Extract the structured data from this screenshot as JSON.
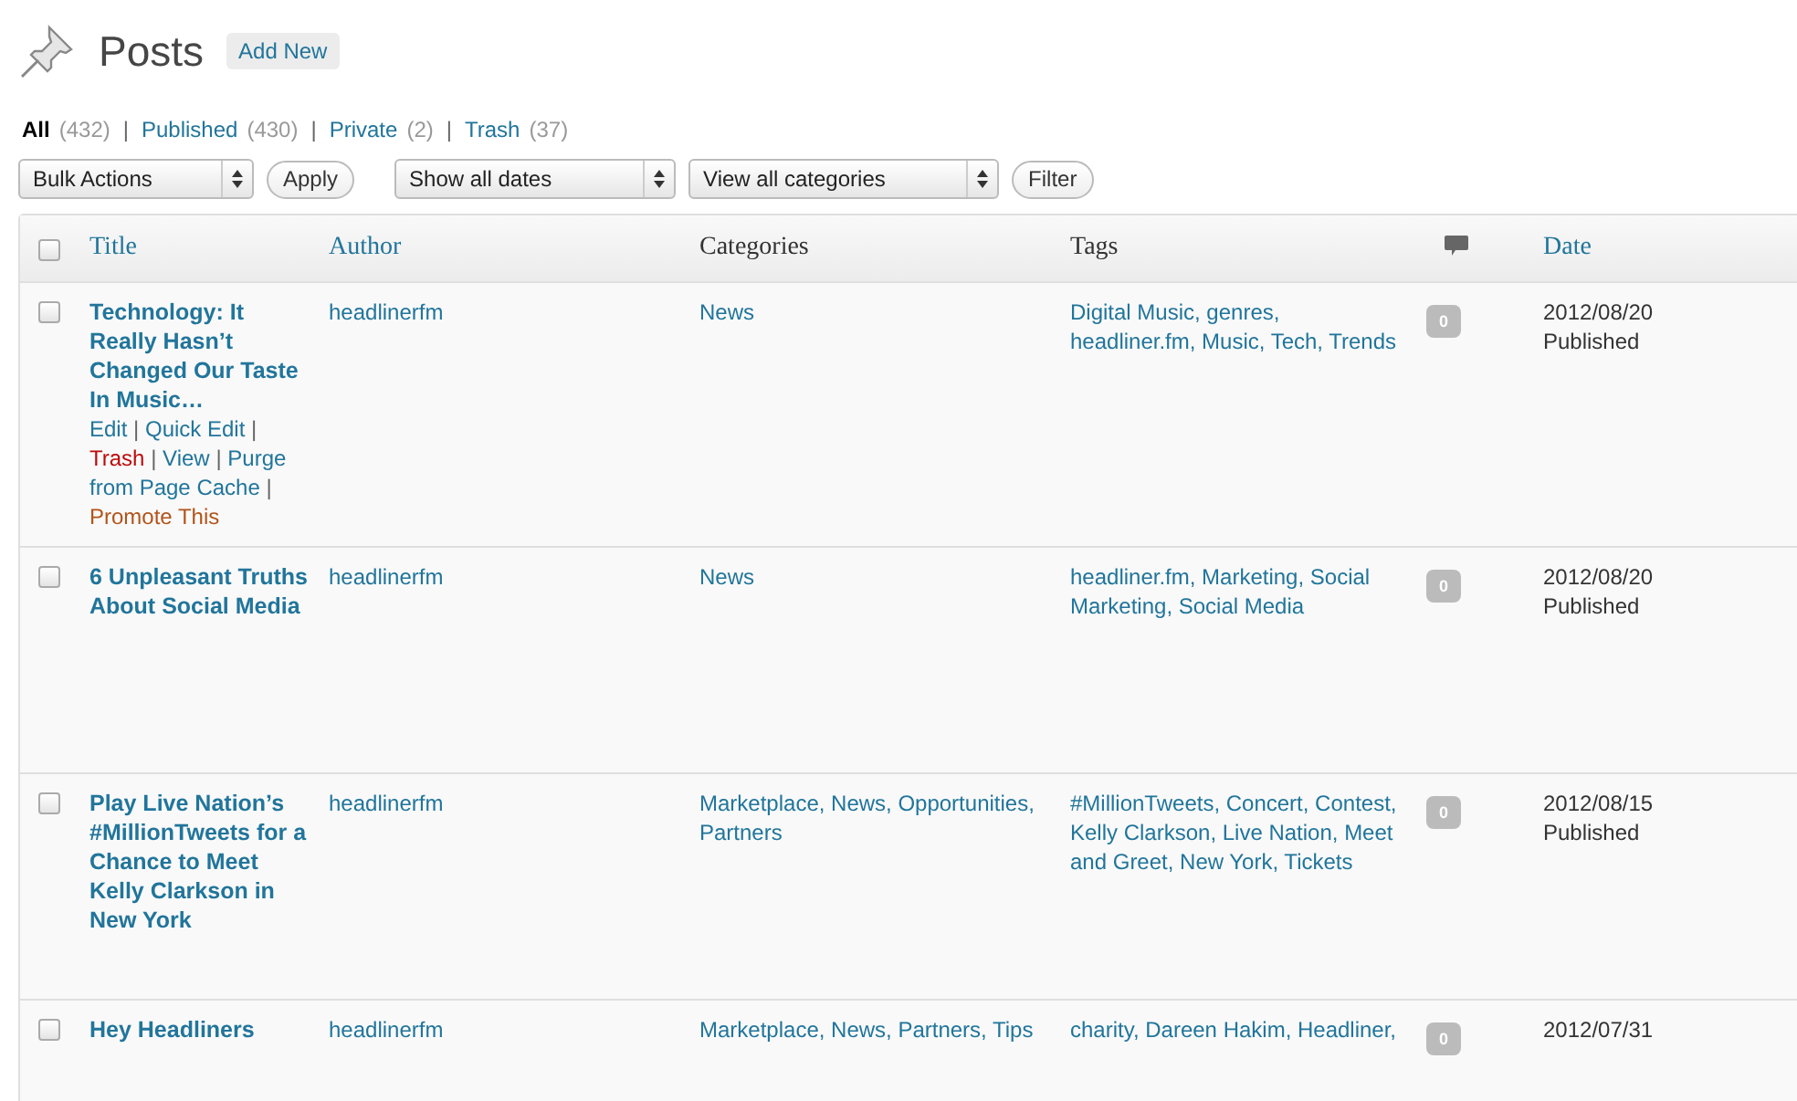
{
  "header": {
    "title": "Posts",
    "add_new": "Add New"
  },
  "status_links": [
    {
      "label": "All",
      "count": "(432)",
      "selected": true
    },
    {
      "label": "Published",
      "count": "(430)",
      "selected": false
    },
    {
      "label": "Private",
      "count": "(2)",
      "selected": false
    },
    {
      "label": "Trash",
      "count": "(37)",
      "selected": false
    }
  ],
  "status_separator": "|",
  "toolbar": {
    "bulk_actions": "Bulk Actions",
    "apply": "Apply",
    "dates": "Show all dates",
    "categories": "View all categories",
    "filter": "Filter"
  },
  "table": {
    "columns": [
      {
        "label": "Title",
        "sortable": true
      },
      {
        "label": "Author",
        "sortable": true
      },
      {
        "label": "Categories",
        "sortable": false
      },
      {
        "label": "Tags",
        "sortable": false
      },
      {
        "label": "Date",
        "sortable": true
      }
    ],
    "select_all_checked": false,
    "action_separator": "|",
    "rows": [
      {
        "checked": false,
        "title": "Technology: It Really Hasn’t Changed Our Taste In Music…",
        "author": "headlinerfm",
        "categories": "News",
        "tags": "Digital Music, genres, headliner.fm, Music, Tech, Trends",
        "comments": "0",
        "date": "2012/08/20",
        "status": "Published",
        "actions": [
          {
            "label": "Edit",
            "kind": "normal"
          },
          {
            "label": "Quick Edit",
            "kind": "normal"
          },
          {
            "label": "Trash",
            "kind": "delete"
          },
          {
            "label": "View",
            "kind": "normal"
          },
          {
            "label": "Purge from Page Cache",
            "kind": "normal"
          },
          {
            "label": "Promote This",
            "kind": "promote"
          }
        ]
      },
      {
        "checked": false,
        "title": "6 Unpleasant Truths About Social Media",
        "author": "headlinerfm",
        "categories": "News",
        "tags": "headliner.fm, Marketing, Social Marketing, Social Media",
        "comments": "0",
        "date": "2012/08/20",
        "status": "Published",
        "actions": []
      },
      {
        "checked": false,
        "title": "Play Live Nation’s #MillionTweets for a Chance to Meet Kelly Clarkson in New York",
        "author": "headlinerfm",
        "categories": "Marketplace, News, Opportunities, Partners",
        "tags": "#MillionTweets, Concert, Contest, Kelly Clarkson, Live Nation, Meet and Greet, New York, Tickets",
        "comments": "0",
        "date": "2012/08/15",
        "status": "Published",
        "actions": []
      },
      {
        "checked": false,
        "title": "Hey Headliners",
        "author": "headlinerfm",
        "categories": "Marketplace, News, Partners, Tips",
        "tags": "charity, Dareen Hakim, Headliner,",
        "comments": "0",
        "date": "2012/07/31",
        "status": "",
        "actions": []
      }
    ]
  }
}
